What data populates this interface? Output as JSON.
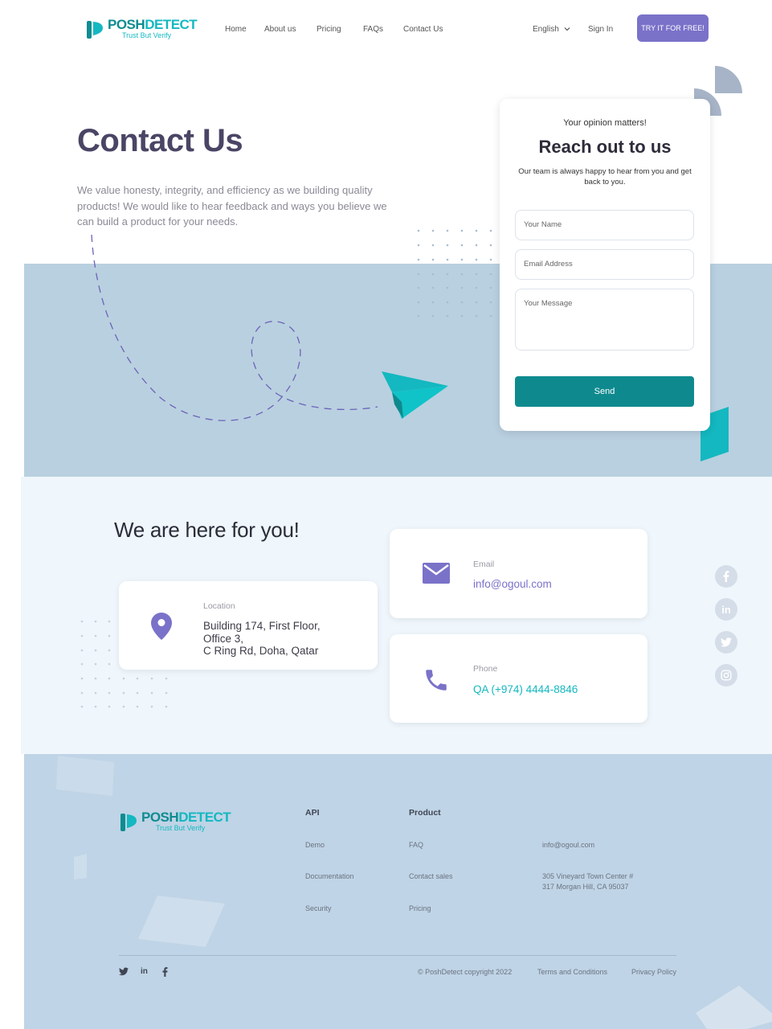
{
  "brand": {
    "name_part1": "POSH",
    "name_part2": "DETECT",
    "tagline": "Trust But Verify"
  },
  "nav": {
    "links": [
      "Home",
      "About us",
      "Pricing",
      "FAQs",
      "Contact Us"
    ],
    "language": "English",
    "signin": "Sign In",
    "cta": "TRY IT FOR FREE!"
  },
  "hero": {
    "title": "Contact Us",
    "body": "We value honesty, integrity, and efficiency as we building quality products! We would like to hear feedback and ways you believe  we can build a product for your needs."
  },
  "form": {
    "eyebrow": "Your opinion matters!",
    "title": "Reach out to us",
    "subtitle": "Our team is always happy to hear from you and get back to you.",
    "name_placeholder": "Your Name",
    "email_placeholder": "Email Address",
    "message_placeholder": "Your Message",
    "send_label": "Send"
  },
  "contact": {
    "title": "We are here for you!",
    "location": {
      "label": "Location",
      "line1": "Building 174, First Floor,",
      "line2": "Office 3,",
      "line3": "C Ring Rd, Doha, Qatar"
    },
    "email": {
      "label": "Email",
      "value": "info@ogoul.com"
    },
    "phone": {
      "label": "Phone",
      "value": "QA (+974) 4444-8846"
    },
    "colors": {
      "icon": "#7a72c9",
      "phone_text": "#14b8c0",
      "email_text": "#7a72c9"
    }
  },
  "side_social": [
    "facebook-icon",
    "linkedin-icon",
    "twitter-icon",
    "instagram-icon"
  ],
  "footer": {
    "col_api": {
      "heading": "API",
      "links": [
        "Demo",
        "Documentation",
        "Security"
      ]
    },
    "col_product": {
      "heading": "Product",
      "links": [
        "FAQ",
        "Contact sales",
        "Pricing"
      ]
    },
    "contact_email": "info@ogoul.com",
    "address_line1": "305 Vineyard Town Center #",
    "address_line2": "317 Morgan Hill, CA 95037",
    "copyright": "© PoshDetect copyright 2022",
    "terms": "Terms and Conditions",
    "privacy": "Privacy Policy",
    "social": [
      "twitter-icon",
      "linkedin-icon",
      "facebook-icon"
    ]
  }
}
